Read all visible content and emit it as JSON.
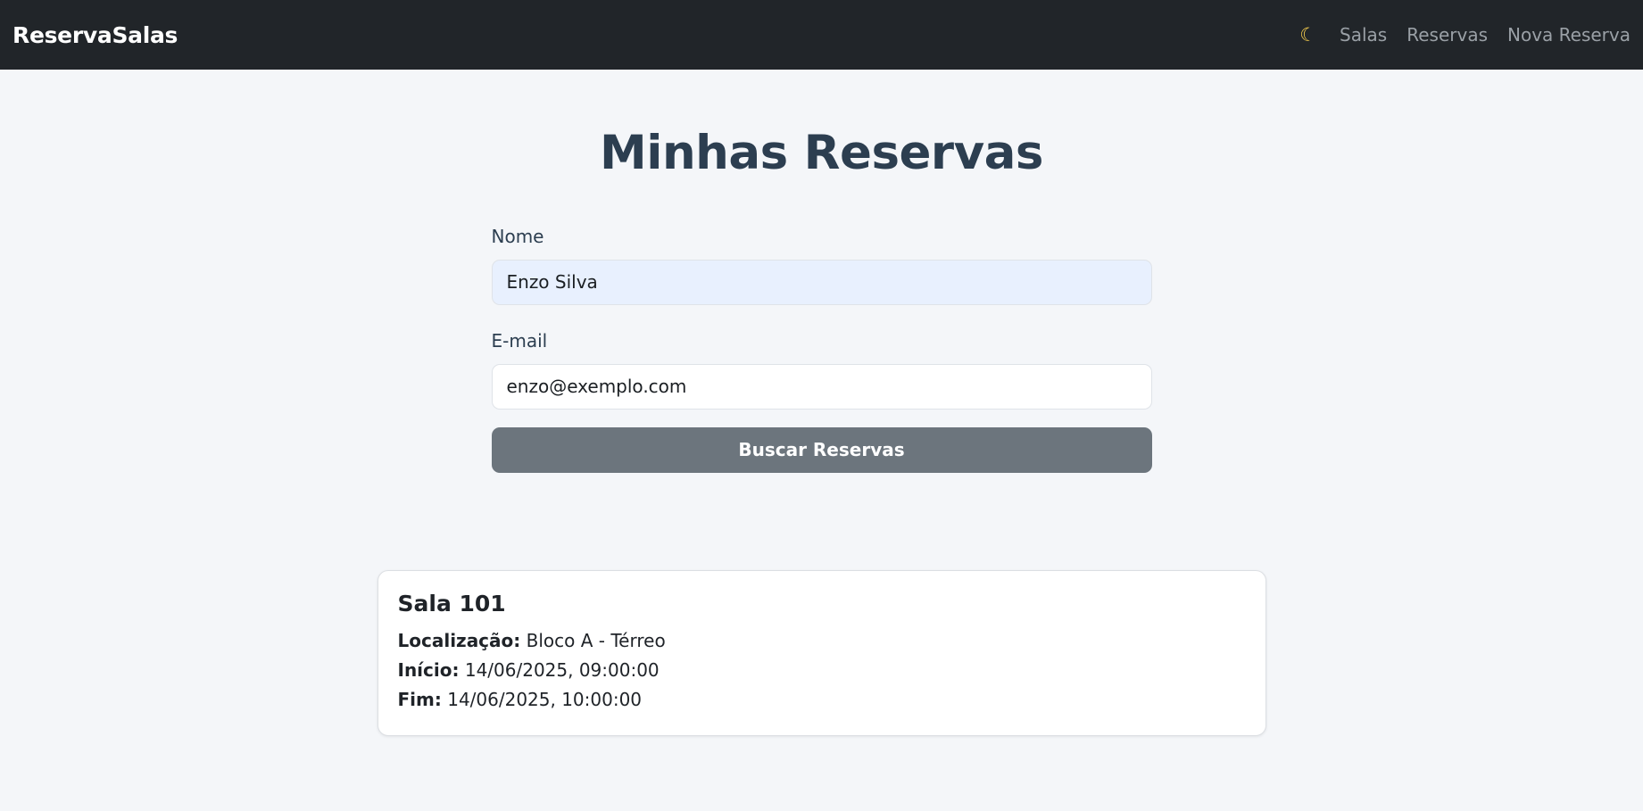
{
  "navbar": {
    "brand": "ReservaSalas",
    "theme_toggle_icon": "moon-icon",
    "links": [
      "Salas",
      "Reservas",
      "Nova Reserva"
    ]
  },
  "page": {
    "title": "Minhas Reservas"
  },
  "form": {
    "name_label": "Nome",
    "name_value": "Enzo Silva",
    "email_label": "E-mail",
    "email_value": "enzo@exemplo.com",
    "submit_label": "Buscar Reservas"
  },
  "reservations": [
    {
      "room": "Sala 101",
      "location_label": "Localização:",
      "location": "Bloco A - Térreo",
      "start_label": "Início:",
      "start": "14/06/2025, 09:00:00",
      "end_label": "Fim:",
      "end": "14/06/2025, 10:00:00"
    }
  ],
  "colors": {
    "navbar_bg": "#212529",
    "button_bg": "#6c757d",
    "title": "#2c3e50",
    "moon": "#f2c94c"
  }
}
